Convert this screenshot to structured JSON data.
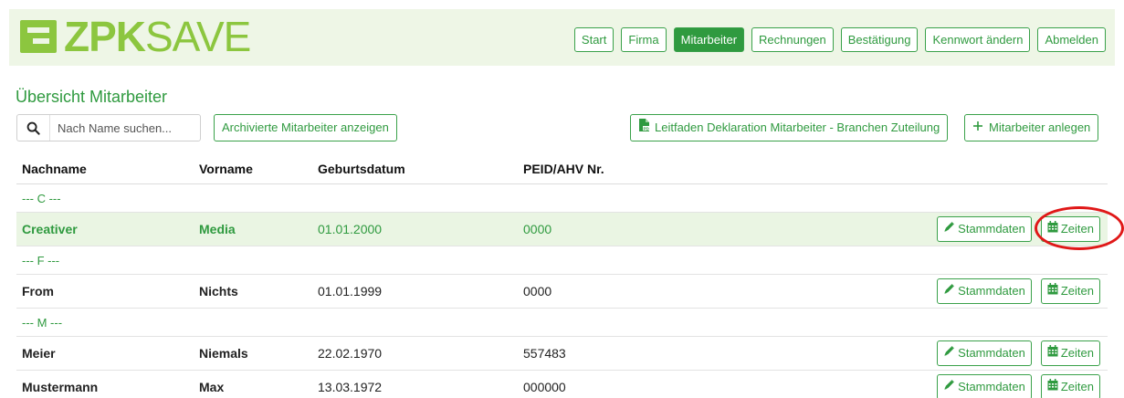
{
  "brand": {
    "bold": "ZPK",
    "light": "SAVE"
  },
  "nav": [
    {
      "label": "Start",
      "active": false
    },
    {
      "label": "Firma",
      "active": false
    },
    {
      "label": "Mitarbeiter",
      "active": true
    },
    {
      "label": "Rechnungen",
      "active": false
    },
    {
      "label": "Bestätigung",
      "active": false
    },
    {
      "label": "Kennwort ändern",
      "active": false
    },
    {
      "label": "Abmelden",
      "active": false
    }
  ],
  "page": {
    "title": "Übersicht Mitarbeiter"
  },
  "search": {
    "placeholder": "Nach Name suchen..."
  },
  "toolbar": {
    "archived_label": "Archivierte Mitarbeiter anzeigen",
    "guide_label": "Leitfaden Deklaration Mitarbeiter - Branchen Zuteilung",
    "add_label": "Mitarbeiter anlegen"
  },
  "table": {
    "headers": {
      "lastname": "Nachname",
      "firstname": "Vorname",
      "birthdate": "Geburtsdatum",
      "peid": "PEID/AHV Nr."
    },
    "action_labels": {
      "master": "Stammdaten",
      "times": "Zeiten"
    },
    "groups": [
      {
        "label": "--- C ---",
        "rows": [
          {
            "lastname": "Creativer",
            "firstname": "Media",
            "birthdate": "01.01.2000",
            "peid": "0000"
          }
        ]
      },
      {
        "label": "--- F ---",
        "rows": [
          {
            "lastname": "From",
            "firstname": "Nichts",
            "birthdate": "01.01.1999",
            "peid": "0000"
          }
        ]
      },
      {
        "label": "--- M ---",
        "rows": [
          {
            "lastname": "Meier",
            "firstname": "Niemals",
            "birthdate": "22.02.1970",
            "peid": "557483"
          },
          {
            "lastname": "Mustermann",
            "firstname": "Max",
            "birthdate": "13.03.1972",
            "peid": "000000"
          }
        ]
      }
    ]
  },
  "colors": {
    "brand_green": "#8cc63f",
    "primary_green": "#2f9a3f",
    "highlight_red": "#e01818"
  }
}
